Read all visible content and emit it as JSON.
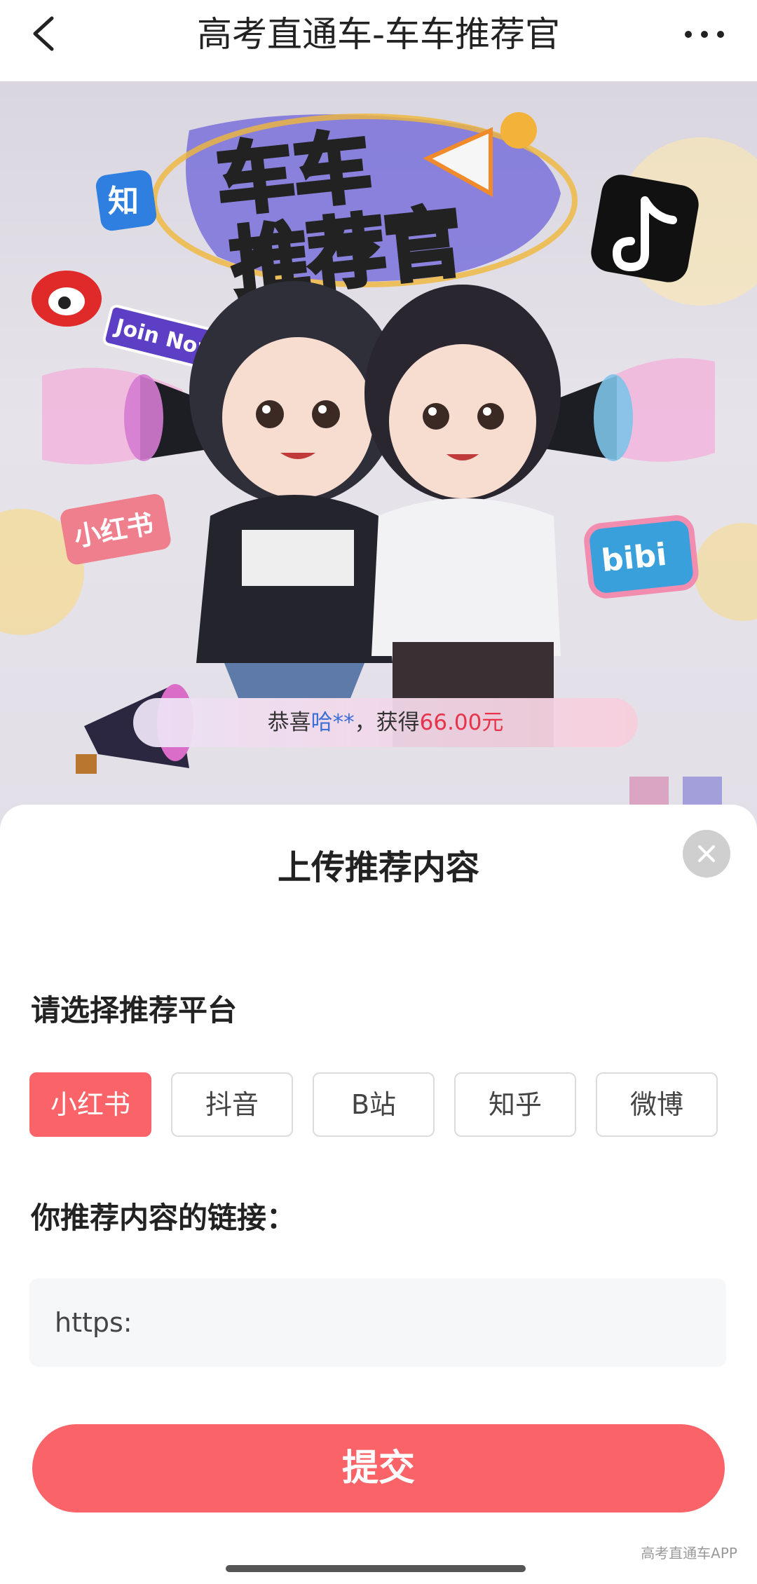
{
  "header": {
    "title": "高考直通车-车车推荐官",
    "back_icon": "chevron-left-icon",
    "more_icon": "more-horizontal-icon"
  },
  "banner": {
    "headline_line1": "车车",
    "headline_line2": "推荐官",
    "join_badge": "Join Now",
    "zhihu_icon_text": "知",
    "xiaohongshu_badge": "小红书",
    "bilibili_badge": "bibi",
    "notice": {
      "prefix": "恭喜",
      "name": "哈**",
      "middle": "，获得",
      "amount": "66.00元"
    }
  },
  "sheet": {
    "title": "上传推荐内容",
    "platform_label": "请选择推荐平台",
    "platforms": [
      {
        "label": "小红书",
        "selected": true
      },
      {
        "label": "抖音",
        "selected": false
      },
      {
        "label": "B站",
        "selected": false
      },
      {
        "label": "知乎",
        "selected": false
      },
      {
        "label": "微博",
        "selected": false
      }
    ],
    "link_label": "你推荐内容的链接：",
    "link_placeholder": "https:",
    "submit_label": "提交"
  },
  "watermark": "高考直通车APP",
  "colors": {
    "accent": "#fa6468",
    "link_blue": "#3c6fd8",
    "amount_red": "#e8344a"
  }
}
